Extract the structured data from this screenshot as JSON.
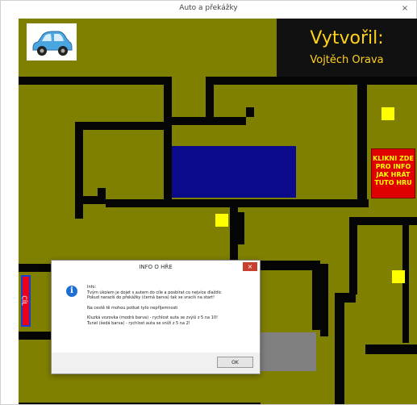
{
  "window": {
    "title": "Auto a překážky",
    "close_label": "×"
  },
  "game": {
    "credit_line1": "Vytvořil:",
    "credit_line2": "Vojtěch Orava",
    "info_button_lines": [
      "KLIKNI ZDE",
      "PRO INFO",
      "JAK HRÁT",
      "TUTO HRU"
    ],
    "goal_label": "CÍL",
    "colors": {
      "ground": "#808000",
      "wall": "#050505",
      "coin": "#ffff00",
      "water": "#0a0a8a",
      "tunnel": "#808080",
      "goal": "#e8001c"
    }
  },
  "dialog": {
    "title": "INFO O HŘE",
    "close_label": "×",
    "icon": "info-icon",
    "lines": [
      "Info:",
      "Tvým úkolem je dojet s autem do cíle a posbírat co nejvíce dlaždic",
      "Pokud narazíš do překážky (černá barva) tak se vracíš na start!"
    ],
    "lines2": [
      "Na cestě tě mohou potkat tyto nepříjemnosti"
    ],
    "lines3": [
      "Kluzká vozovka (modrá barva) - rychlost auta se zvýší z 5 na 10!",
      "Tunel (šedá barva) - rychlost auta se sníží z 5 na 2!"
    ],
    "ok_label": "OK"
  }
}
